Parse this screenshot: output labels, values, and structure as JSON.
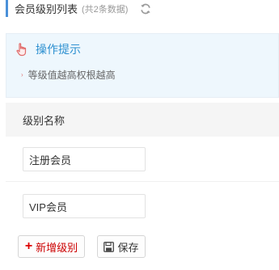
{
  "header": {
    "title": "会员级别列表",
    "count": "(共2条数据)",
    "refresh_icon": "refresh-icon"
  },
  "tip": {
    "icon": "hand-pointer-icon",
    "title": "操作提示",
    "items": [
      "等级值越高权根越高"
    ]
  },
  "table": {
    "column_header": "级别名称",
    "rows": [
      {
        "name": "注册会员"
      },
      {
        "name": "VIP会员"
      }
    ]
  },
  "actions": {
    "add_label": "新增级别",
    "save_label": "保存"
  },
  "colors": {
    "accent": "#4a90d9",
    "tip_title": "#2b8fd0",
    "tip_bg": "#eef7fd",
    "add_text": "#cc0000"
  }
}
